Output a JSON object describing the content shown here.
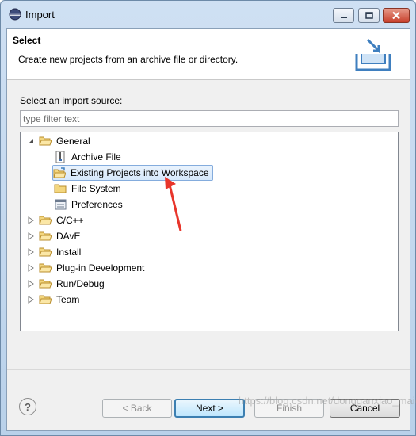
{
  "window": {
    "title": "Import",
    "app_icon": "eclipse-icon",
    "controls": [
      "minimize-icon",
      "maximize-icon",
      "close-icon"
    ]
  },
  "header": {
    "title": "Select",
    "description": "Create new projects from an archive file or directory.",
    "icon": "import-tray-icon"
  },
  "source": {
    "label": "Select an import source:",
    "filter_placeholder": "type filter text",
    "filter_value": ""
  },
  "tree": {
    "general": {
      "label": "General",
      "expanded": true,
      "children": {
        "archive": {
          "label": "Archive File",
          "icon": "archive-icon"
        },
        "existing": {
          "label": "Existing Projects into Workspace",
          "icon": "project-folder-icon",
          "selected": true
        },
        "filesystem": {
          "label": "File System",
          "icon": "folder-icon"
        },
        "preferences": {
          "label": "Preferences",
          "icon": "preferences-icon"
        }
      }
    },
    "groups": {
      "cpp": {
        "label": "C/C++"
      },
      "dave": {
        "label": "DAvE"
      },
      "install": {
        "label": "Install"
      },
      "plugin": {
        "label": "Plug-in Development"
      },
      "rundebug": {
        "label": "Run/Debug"
      },
      "team": {
        "label": "Team"
      }
    }
  },
  "buttons": {
    "help": "?",
    "back": "< Back",
    "next": "Next >",
    "finish": "Finish",
    "cancel": "Cancel"
  },
  "watermark": "https://blog.csdn.net/dongganxiao_maidou",
  "colors": {
    "selection_bg": "#d6e8fb",
    "selection_border": "#84acdd",
    "pointer_arrow": "#e8352b",
    "folder": "#e8c36a"
  }
}
